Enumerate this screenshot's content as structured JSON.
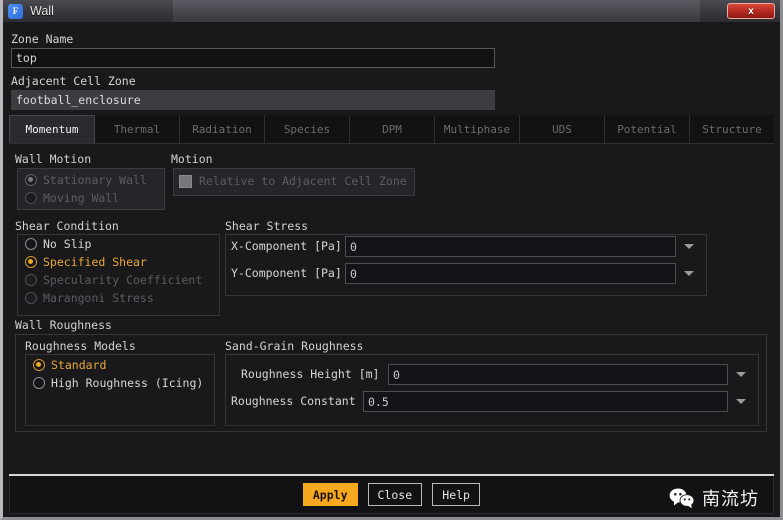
{
  "window": {
    "title": "Wall",
    "app_icon": "fluent-f-icon",
    "close_label": "x"
  },
  "zone": {
    "name_label": "Zone Name",
    "name_value": "top",
    "adjacent_label": "Adjacent Cell Zone",
    "adjacent_value": "football_enclosure"
  },
  "tabs": [
    {
      "label": "Momentum",
      "active": true
    },
    {
      "label": "Thermal",
      "active": false
    },
    {
      "label": "Radiation",
      "active": false
    },
    {
      "label": "Species",
      "active": false
    },
    {
      "label": "DPM",
      "active": false
    },
    {
      "label": "Multiphase",
      "active": false
    },
    {
      "label": "UDS",
      "active": false
    },
    {
      "label": "Potential",
      "active": false
    },
    {
      "label": "Structure",
      "active": false
    }
  ],
  "wall_motion": {
    "group_label": "Wall Motion",
    "options": [
      {
        "label": "Stationary Wall",
        "selected": true,
        "disabled": true
      },
      {
        "label": "Moving Wall",
        "selected": false,
        "disabled": true
      }
    ]
  },
  "motion": {
    "group_label": "Motion",
    "checkbox_label": "Relative to Adjacent Cell Zone",
    "checked": true,
    "disabled": true
  },
  "shear_condition": {
    "group_label": "Shear Condition",
    "options": [
      {
        "label": "No Slip",
        "selected": false,
        "disabled": false
      },
      {
        "label": "Specified Shear",
        "selected": true,
        "disabled": false
      },
      {
        "label": "Specularity Coefficient",
        "selected": false,
        "disabled": true
      },
      {
        "label": "Marangoni Stress",
        "selected": false,
        "disabled": true
      }
    ]
  },
  "shear_stress": {
    "group_label": "Shear Stress",
    "fields": [
      {
        "label": "X-Component [Pa]",
        "value": "0"
      },
      {
        "label": "Y-Component [Pa]",
        "value": "0"
      }
    ]
  },
  "wall_roughness": {
    "group_label": "Wall Roughness",
    "models": {
      "group_label": "Roughness Models",
      "options": [
        {
          "label": "Standard",
          "selected": true,
          "disabled": false
        },
        {
          "label": "High Roughness (Icing)",
          "selected": false,
          "disabled": false
        }
      ]
    },
    "sand_grain": {
      "group_label": "Sand-Grain Roughness",
      "fields": [
        {
          "label": "Roughness Height [m]",
          "value": "0"
        },
        {
          "label": "Roughness Constant",
          "value": "0.5"
        }
      ]
    }
  },
  "footer": {
    "buttons": [
      {
        "label": "Apply",
        "primary": true
      },
      {
        "label": "Close",
        "primary": false
      },
      {
        "label": "Help",
        "primary": false
      }
    ],
    "watermark_text": "南流坊",
    "watermark_icon": "wechat-icon"
  },
  "colors": {
    "accent": "#f6a81e",
    "selected_radio": "#f0a821",
    "selected_text": "#e8a83a",
    "window_bg": "#19191c",
    "close_red": "#b52a20",
    "disabled_text": "#5c5c63"
  }
}
